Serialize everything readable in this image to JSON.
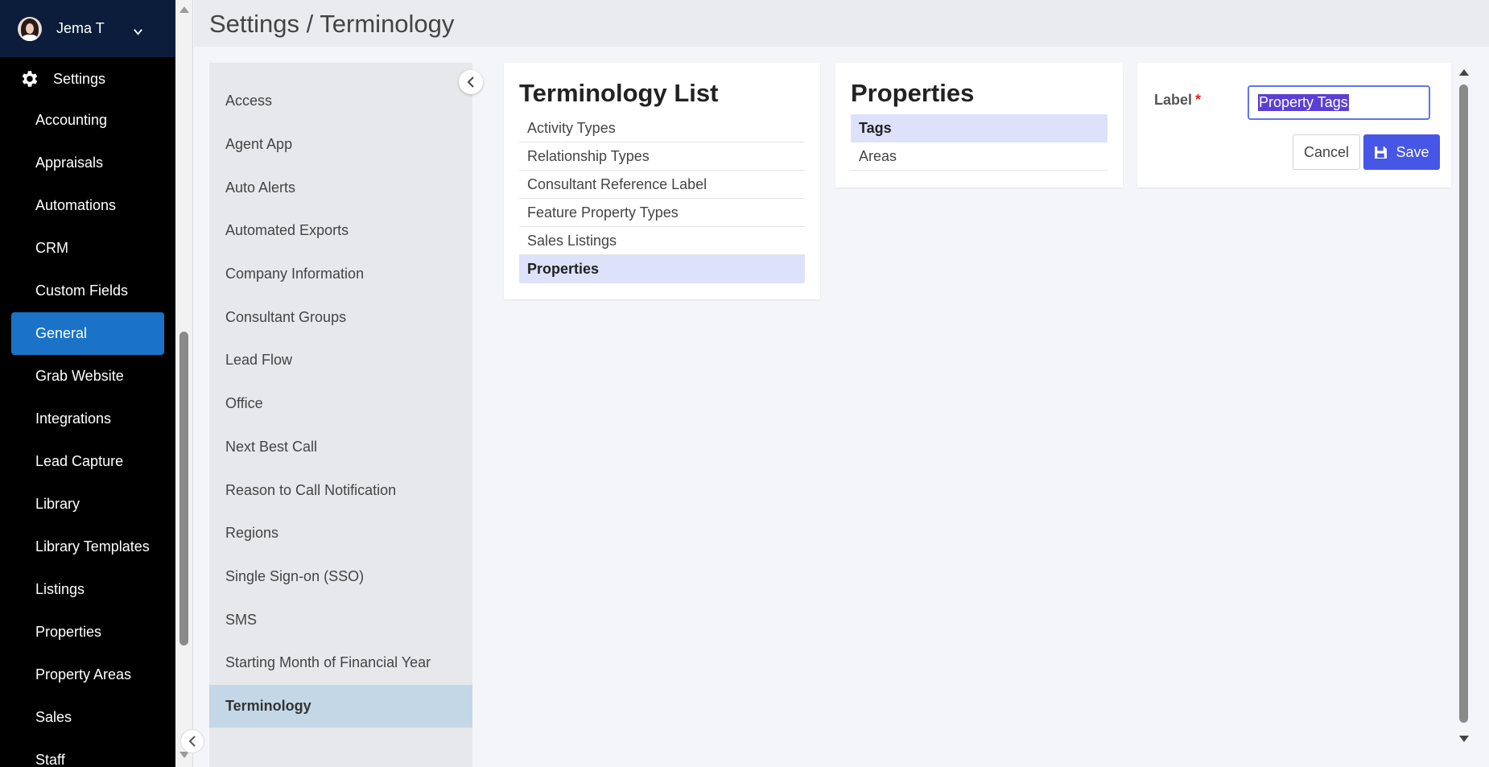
{
  "user": {
    "name": "Jema T"
  },
  "settings_label": "Settings",
  "nav_items": [
    "Accounting",
    "Appraisals",
    "Automations",
    "CRM",
    "Custom Fields",
    "General",
    "Grab Website",
    "Integrations",
    "Lead Capture",
    "Library",
    "Library Templates",
    "Listings",
    "Properties",
    "Property Areas",
    "Sales",
    "Staff"
  ],
  "nav_active": "General",
  "page_title": "Settings / Terminology",
  "submenu_items": [
    "Access",
    "Agent App",
    "Auto Alerts",
    "Automated Exports",
    "Company Information",
    "Consultant Groups",
    "Lead Flow",
    "Office",
    "Next Best Call",
    "Reason to Call Notification",
    "Regions",
    "Single Sign-on (SSO)",
    "SMS",
    "Starting Month of Financial Year",
    "Terminology"
  ],
  "submenu_active": "Terminology",
  "terminology": {
    "title": "Terminology List",
    "items": [
      "Activity Types",
      "Relationship Types",
      "Consultant Reference Label",
      "Feature Property Types",
      "Sales Listings",
      "Properties"
    ],
    "active": "Properties"
  },
  "properties": {
    "title": "Properties",
    "items": [
      "Tags",
      "Areas"
    ],
    "active": "Tags"
  },
  "form": {
    "label_text": "Label",
    "required_mark": "*",
    "input_value": "Property Tags",
    "cancel_label": "Cancel",
    "save_label": "Save"
  },
  "colors": {
    "sidebar_bg": "#000000",
    "nav_active_bg": "#1a73c6",
    "save_button": "#4656e6",
    "list_active_bg": "#dde2fa",
    "submenu_active_bg": "#c4d7e6"
  }
}
